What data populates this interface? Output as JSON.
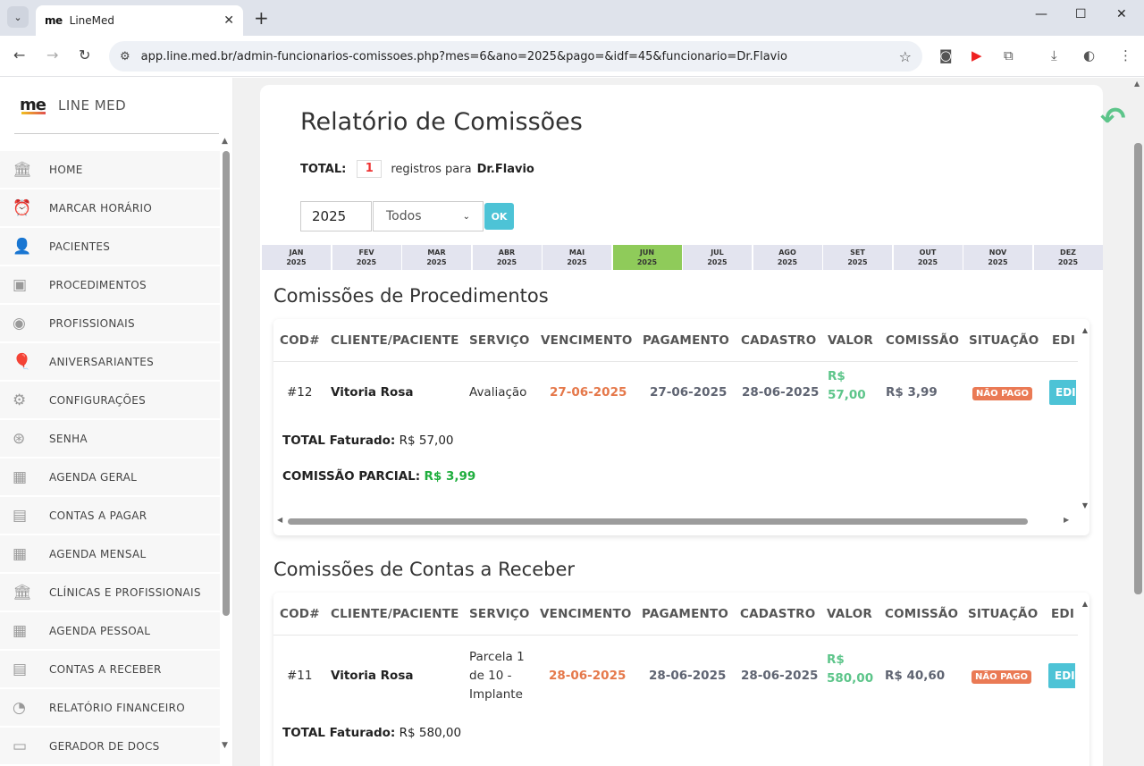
{
  "browser": {
    "tab_title": "LineMed",
    "tab_favicon": "me",
    "url": "app.line.med.br/admin-funcionarios-comissoes.php?mes=6&ano=2025&pago=&idf=45&funcionario=Dr.Flavio"
  },
  "sidebar": {
    "logo_mark": "me",
    "logo_name": "LINE MED",
    "items": [
      {
        "label": "HOME",
        "icon": "bank-icon",
        "glyph": "🏛"
      },
      {
        "label": "MARCAR HORÁRIO",
        "icon": "alarm-clock-icon",
        "glyph": "⏰"
      },
      {
        "label": "PACIENTES",
        "icon": "user-icon",
        "glyph": "👤"
      },
      {
        "label": "PROCEDIMENTOS",
        "icon": "box-icon",
        "glyph": "▣"
      },
      {
        "label": "PROFISSIONAIS",
        "icon": "user-circle-icon",
        "glyph": "◉"
      },
      {
        "label": "ANIVERSARIANTES",
        "icon": "balloon-icon",
        "glyph": "🎈"
      },
      {
        "label": "CONFIGURAÇÕES",
        "icon": "gear-icon",
        "glyph": "⚙"
      },
      {
        "label": "SENHA",
        "icon": "fingerprint-icon",
        "glyph": "⊛"
      },
      {
        "label": "AGENDA GERAL",
        "icon": "calendar-icon",
        "glyph": "▦"
      },
      {
        "label": "CONTAS A PAGAR",
        "icon": "money-icon",
        "glyph": "▤"
      },
      {
        "label": "AGENDA MENSAL",
        "icon": "calendar-icon",
        "glyph": "▦"
      },
      {
        "label": "CLÍNICAS E PROFISSIONAIS",
        "icon": "bank-icon",
        "glyph": "🏛"
      },
      {
        "label": "AGENDA PESSOAL",
        "icon": "calendar-icon",
        "glyph": "▦"
      },
      {
        "label": "CONTAS A RECEBER",
        "icon": "money-icon",
        "glyph": "▤"
      },
      {
        "label": "RELATÓRIO FINANCEIRO",
        "icon": "pie-chart-icon",
        "glyph": "◔"
      },
      {
        "label": "GERADOR DE DOCS",
        "icon": "id-card-icon",
        "glyph": "▭"
      }
    ]
  },
  "main": {
    "title": "Relatório de Comissões",
    "total_label": "TOTAL:",
    "total_count": "1",
    "registros_text": "registros para",
    "funcionario": "Dr.Flavio",
    "year_value": "2025",
    "pago_selected": "Todos",
    "ok_label": "OK",
    "months": [
      {
        "m": "JAN",
        "y": "2025",
        "active": false
      },
      {
        "m": "FEV",
        "y": "2025",
        "active": false
      },
      {
        "m": "MAR",
        "y": "2025",
        "active": false
      },
      {
        "m": "ABR",
        "y": "2025",
        "active": false
      },
      {
        "m": "MAI",
        "y": "2025",
        "active": false
      },
      {
        "m": "JUN",
        "y": "2025",
        "active": true
      },
      {
        "m": "JUL",
        "y": "2025",
        "active": false
      },
      {
        "m": "AGO",
        "y": "2025",
        "active": false
      },
      {
        "m": "SET",
        "y": "2025",
        "active": false
      },
      {
        "m": "OUT",
        "y": "2025",
        "active": false
      },
      {
        "m": "NOV",
        "y": "2025",
        "active": false
      },
      {
        "m": "DEZ",
        "y": "2025",
        "active": false
      }
    ],
    "columns": [
      "COD#",
      "CLIENTE/PACIENTE",
      "SERVIÇO",
      "VENCIMENTO",
      "PAGAMENTO",
      "CADASTRO",
      "VALOR",
      "COMISSÃO",
      "SITUAÇÃO",
      "EDI"
    ],
    "procedimentos": {
      "title": "Comissões de Procedimentos",
      "row": {
        "cod": "#12",
        "cliente": "Vitoria Rosa",
        "servico": "Avaliação",
        "vencimento": "27-06-2025",
        "pagamento": "27-06-2025",
        "cadastro": "28-06-2025",
        "valor_l1": "R$",
        "valor_l2": "57,00",
        "comissao": "R$ 3,99",
        "situacao": "NÃO PAGO",
        "edit": "EDI"
      },
      "total_faturado_label": "TOTAL Faturado:",
      "total_faturado_value": "R$ 57,00",
      "comissao_parcial_label": "COMISSÃO PARCIAL:",
      "comissao_parcial_value": "R$ 3,99"
    },
    "contas": {
      "title": "Comissões de Contas a Receber",
      "row": {
        "cod": "#11",
        "cliente": "Vitoria Rosa",
        "servico_l1": "Parcela 1",
        "servico_l2": "de 10 -",
        "servico_l3": "Implante",
        "vencimento": "28-06-2025",
        "pagamento": "28-06-2025",
        "cadastro": "28-06-2025",
        "valor_l1": "R$",
        "valor_l2": "580,00",
        "comissao": "R$ 40,60",
        "situacao": "NÃO PAGO",
        "edit": "EDI"
      },
      "total_faturado_label": "TOTAL Faturado:",
      "total_faturado_value": "R$ 580,00"
    }
  }
}
